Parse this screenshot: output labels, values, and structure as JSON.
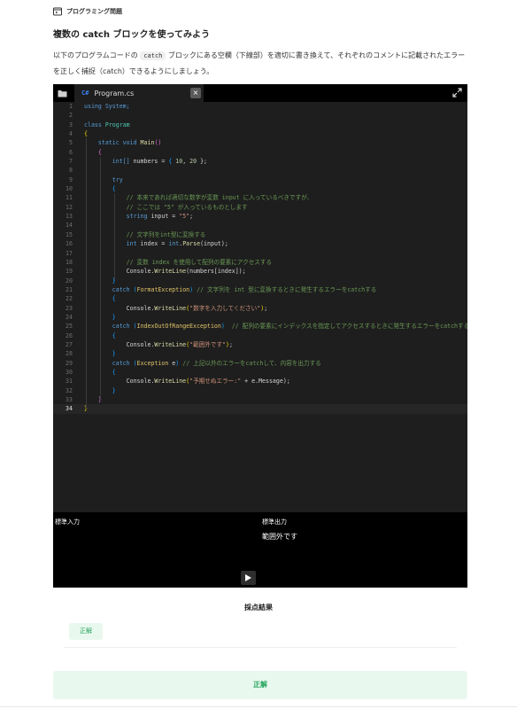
{
  "header": {
    "category": "プログラミング問題",
    "title": "複数の catch ブロックを使ってみよう",
    "desc_part1": "以下のプログラムコードの ",
    "desc_code": "catch",
    "desc_part2": " ブロックにある空欄（下線部）を適切に書き換えて、それぞれのコメントに記載されたエラーを正しく捕捉（catch）できるようにしましょう。"
  },
  "editor": {
    "tab_lang": "C#",
    "tab_name": "Program.cs",
    "tab_close": "×",
    "code": {
      "l1": "using System;",
      "l3a": "class",
      "l3b": "Program",
      "l5a": "static void",
      "l5b": "Main",
      "l7a": "int[]",
      "l7b": " numbers = ",
      "l7c": " 10",
      "l7d": ", ",
      "l7e": "20",
      "l7f": " };",
      "l9": "try",
      "l11": "// 本来であれば適切な数字が変数 input に入っているべきですが、",
      "l12": "// ここでは \"5\" が入っているものとします",
      "l13a": "string",
      "l13b": " input = ",
      "l13c": "\"5\"",
      "l13d": ";",
      "l15": "// 文字列をint型に変換する",
      "l16a": "int",
      "l16b": " index = ",
      "l16c": "int",
      "l16d": ".",
      "l16e": "Parse",
      "l16f": "(input);",
      "l18": "// 変数 index を使用して配列の要素にアクセスする",
      "l19a": "Console.",
      "l19b": "WriteLine",
      "l19c": "(numbers[index]);",
      "l21a": "catch",
      "l21b": "FormatException",
      "l21c": "// 文字列を int 型に変換するときに発生するエラーをcatchする",
      "l23a": "Console.",
      "l23b": "WriteLine",
      "l23c": "\"数字を入力してください\"",
      "l25a": "catch",
      "l25b": "IndexOutOfRangeException",
      "l25c": "// 配列の要素にインデックスを指定してアクセスするときに発生するエラーをcatchする",
      "l27a": "Console.",
      "l27b": "WriteLine",
      "l27c": "\"範囲外です\"",
      "l29a": "catch",
      "l29b": "Exception",
      "l29c": " e",
      "l29d": "// 上記以外のエラーをcatchして、内容を出力する",
      "l31a": "Console.",
      "l31b": "WriteLine",
      "l31c": "\"予期せぬエラー:\"",
      "l31d": " + e.Message",
      "l31e": ");"
    },
    "stdin_label": "標準入力",
    "stdout_label": "標準出力",
    "stdout_value": "範囲外です"
  },
  "result": {
    "title": "採点結果",
    "badge": "正解",
    "final": "正解"
  },
  "colors": {
    "success_bg": "#e9f8ef",
    "success_text": "#23a35a",
    "editor_bg": "#1e1e1e"
  }
}
